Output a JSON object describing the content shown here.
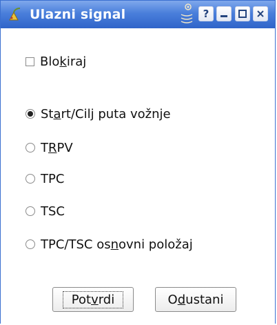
{
  "window": {
    "title": "Ulazni signal",
    "buttons": {
      "help": "?"
    }
  },
  "options": {
    "blokiraj": {
      "pre": "Blo",
      "u": "k",
      "post": "iraj",
      "checked": false
    }
  },
  "radios": [
    {
      "pre": "St",
      "u": "a",
      "post": "rt/Cilj puta vožnje",
      "checked": true
    },
    {
      "pre": "T",
      "u": "R",
      "post": "PV",
      "checked": false
    },
    {
      "pre": "TPC",
      "u": "",
      "post": "",
      "checked": false
    },
    {
      "pre": "TSC",
      "u": "",
      "post": "",
      "checked": false
    },
    {
      "pre": "TPC/TSC os",
      "u": "n",
      "post": "ovni položaj",
      "checked": false
    }
  ],
  "actions": {
    "ok": {
      "pre": "Pot",
      "u": "v",
      "post": "rdi"
    },
    "cancel": {
      "pre": "O",
      "u": "d",
      "post": "ustani"
    }
  },
  "colors": {
    "titlebar": "#3d72d6",
    "accent": "#2f64c9"
  }
}
